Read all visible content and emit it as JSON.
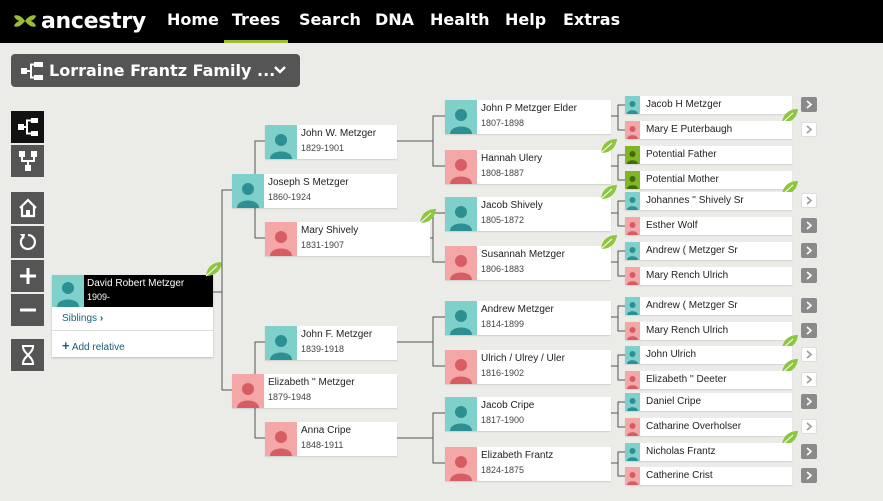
{
  "nav": {
    "logo": "ancestry",
    "items": [
      "Home",
      "Trees",
      "Search",
      "DNA",
      "Health",
      "Help",
      "Extras"
    ],
    "active": "Trees"
  },
  "tree_selector": {
    "label": "Lorraine Frantz Family ..."
  },
  "toolbar": [
    "pedigree-view",
    "family-view",
    "home",
    "reset",
    "zoom-in",
    "zoom-out",
    "dna"
  ],
  "home_person": {
    "name": "David Robert Metzger",
    "dates": "1909-",
    "siblings": "Siblings",
    "add_relative": "Add relative"
  },
  "gen2": [
    {
      "name": "Joseph S Metzger",
      "dates": "1860-1924"
    },
    {
      "name": "Elizabeth '' Metzger",
      "dates": "1879-1948"
    }
  ],
  "gen3": [
    {
      "name": "John W. Metzger",
      "dates": "1829-1901"
    },
    {
      "name": "Mary Shively",
      "dates": "1831-1907"
    },
    {
      "name": "John F. Metzger",
      "dates": "1839-1918"
    },
    {
      "name": "Anna Cripe",
      "dates": "1848-1911"
    }
  ],
  "gen4": [
    {
      "name": "John P Metzger Elder",
      "dates": "1807-1898"
    },
    {
      "name": "Hannah Ulery",
      "dates": "1808-1887"
    },
    {
      "name": "Jacob Shively",
      "dates": "1805-1872"
    },
    {
      "name": "Susannah Metzger",
      "dates": "1806-1883"
    },
    {
      "name": "Andrew Metzger",
      "dates": "1814-1899"
    },
    {
      "name": "Ulrich / Ulrey / Uler",
      "dates": "1816-1902"
    },
    {
      "name": "Jacob Cripe",
      "dates": "1817-1900"
    },
    {
      "name": "Elizabeth Frantz",
      "dates": "1824-1875"
    }
  ],
  "gen5": [
    {
      "name": "Jacob H Metzger"
    },
    {
      "name": "Mary E Puterbaugh"
    },
    {
      "name": "Potential Father"
    },
    {
      "name": "Potential Mother"
    },
    {
      "name": "Johannes '' Shively Sr"
    },
    {
      "name": "Esther Wolf"
    },
    {
      "name": "Andrew ( Metzger Sr"
    },
    {
      "name": "Mary Rench Ulrich"
    },
    {
      "name": "Andrew ( Metzger Sr"
    },
    {
      "name": "Mary Rench Ulrich"
    },
    {
      "name": "John Ulrich"
    },
    {
      "name": "Elizabeth '' Deeter"
    },
    {
      "name": "Daniel Cripe"
    },
    {
      "name": "Catharine Overholser"
    },
    {
      "name": "Nicholas Frantz"
    },
    {
      "name": "Catherine Crist"
    }
  ],
  "colors": {
    "male": "#7fcfcb",
    "female": "#f3a7a7",
    "hint": "#8dc63f",
    "accent": "#9cbe30"
  }
}
